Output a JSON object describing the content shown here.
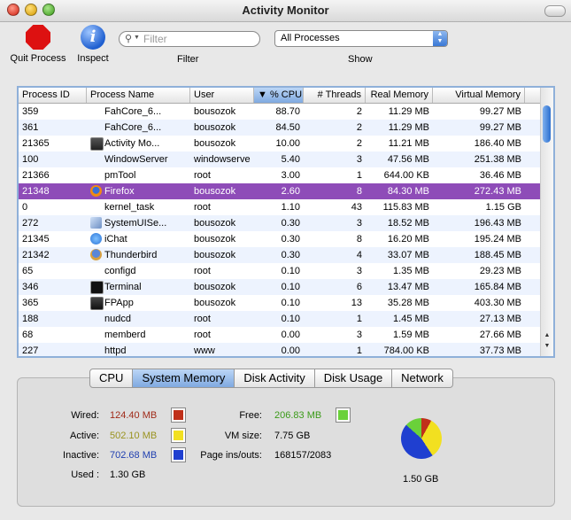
{
  "window": {
    "title": "Activity Monitor"
  },
  "toolbar": {
    "quit_label": "Quit Process",
    "inspect_label": "Inspect",
    "filter_placeholder": "Filter",
    "filter_label": "Filter",
    "show_value": "All Processes",
    "show_label": "Show"
  },
  "table": {
    "columns": [
      "Process ID",
      "Process Name",
      "User",
      "% CPU",
      "# Threads",
      "Real Memory",
      "Virtual Memory"
    ],
    "sort_indicator": "▼",
    "rows": [
      {
        "pid": "359",
        "name": "FahCore_6...",
        "user": "bousozok",
        "cpu": "88.70",
        "threads": "2",
        "real": "11.29 MB",
        "virtual": "99.27 MB",
        "icon": ""
      },
      {
        "pid": "361",
        "name": "FahCore_6...",
        "user": "bousozok",
        "cpu": "84.50",
        "threads": "2",
        "real": "11.29 MB",
        "virtual": "99.27 MB",
        "icon": ""
      },
      {
        "pid": "21365",
        "name": "Activity Mo...",
        "user": "bousozok",
        "cpu": "10.00",
        "threads": "2",
        "real": "11.21 MB",
        "virtual": "186.40 MB",
        "icon": "activity-monitor-icon"
      },
      {
        "pid": "100",
        "name": "WindowServer",
        "user": "windowserve",
        "cpu": "5.40",
        "threads": "3",
        "real": "47.56 MB",
        "virtual": "251.38 MB",
        "icon": ""
      },
      {
        "pid": "21366",
        "name": "pmTool",
        "user": "root",
        "cpu": "3.00",
        "threads": "1",
        "real": "644.00 KB",
        "virtual": "36.46 MB",
        "icon": ""
      },
      {
        "pid": "21348",
        "name": "Firefox",
        "user": "bousozok",
        "cpu": "2.60",
        "threads": "8",
        "real": "84.30 MB",
        "virtual": "272.43 MB",
        "icon": "firefox-icon"
      },
      {
        "pid": "0",
        "name": "kernel_task",
        "user": "root",
        "cpu": "1.10",
        "threads": "43",
        "real": "115.83 MB",
        "virtual": "1.15 GB",
        "icon": ""
      },
      {
        "pid": "272",
        "name": "SystemUISe...",
        "user": "bousozok",
        "cpu": "0.30",
        "threads": "3",
        "real": "18.52 MB",
        "virtual": "196.43 MB",
        "icon": "systemuiserver-icon"
      },
      {
        "pid": "21345",
        "name": "iChat",
        "user": "bousozok",
        "cpu": "0.30",
        "threads": "8",
        "real": "16.20 MB",
        "virtual": "195.24 MB",
        "icon": "ichat-icon"
      },
      {
        "pid": "21342",
        "name": "Thunderbird",
        "user": "bousozok",
        "cpu": "0.30",
        "threads": "4",
        "real": "33.07 MB",
        "virtual": "188.45 MB",
        "icon": "thunderbird-icon"
      },
      {
        "pid": "65",
        "name": "configd",
        "user": "root",
        "cpu": "0.10",
        "threads": "3",
        "real": "1.35 MB",
        "virtual": "29.23 MB",
        "icon": ""
      },
      {
        "pid": "346",
        "name": "Terminal",
        "user": "bousozok",
        "cpu": "0.10",
        "threads": "6",
        "real": "13.47 MB",
        "virtual": "165.84 MB",
        "icon": "terminal-icon"
      },
      {
        "pid": "365",
        "name": "FPApp",
        "user": "bousozok",
        "cpu": "0.10",
        "threads": "13",
        "real": "35.28 MB",
        "virtual": "403.30 MB",
        "icon": "fpapp-icon"
      },
      {
        "pid": "188",
        "name": "nudcd",
        "user": "root",
        "cpu": "0.10",
        "threads": "1",
        "real": "1.45 MB",
        "virtual": "27.13 MB",
        "icon": ""
      },
      {
        "pid": "68",
        "name": "memberd",
        "user": "root",
        "cpu": "0.00",
        "threads": "3",
        "real": "1.59 MB",
        "virtual": "27.66 MB",
        "icon": ""
      },
      {
        "pid": "227",
        "name": "httpd",
        "user": "www",
        "cpu": "0.00",
        "threads": "1",
        "real": "784.00 KB",
        "virtual": "37.73 MB",
        "icon": ""
      }
    ],
    "selected_pid": "21348"
  },
  "tabs": [
    "CPU",
    "System Memory",
    "Disk Activity",
    "Disk Usage",
    "Network"
  ],
  "active_tab": "System Memory",
  "memory": {
    "wired_label": "Wired:",
    "wired_value": "124.40 MB",
    "wired_color": "#c0301a",
    "active_label": "Active:",
    "active_value": "502.10 MB",
    "active_color": "#f2e020",
    "inactive_label": "Inactive:",
    "inactive_value": "702.68 MB",
    "inactive_color": "#1f3fd0",
    "used_label": "Used :",
    "used_value": "1.30 GB",
    "free_label": "Free:",
    "free_value": "206.83 MB",
    "free_color": "#6ad13a",
    "vmsize_label": "VM size:",
    "vmsize_value": "7.75 GB",
    "pageins_label": "Page ins/outs:",
    "pageins_value": "168157/2083",
    "total_value": "1.50 GB"
  },
  "colors": {
    "selection": "#8e4cb8",
    "stripe": "#edf3fe",
    "accent": "#3a78d6"
  }
}
